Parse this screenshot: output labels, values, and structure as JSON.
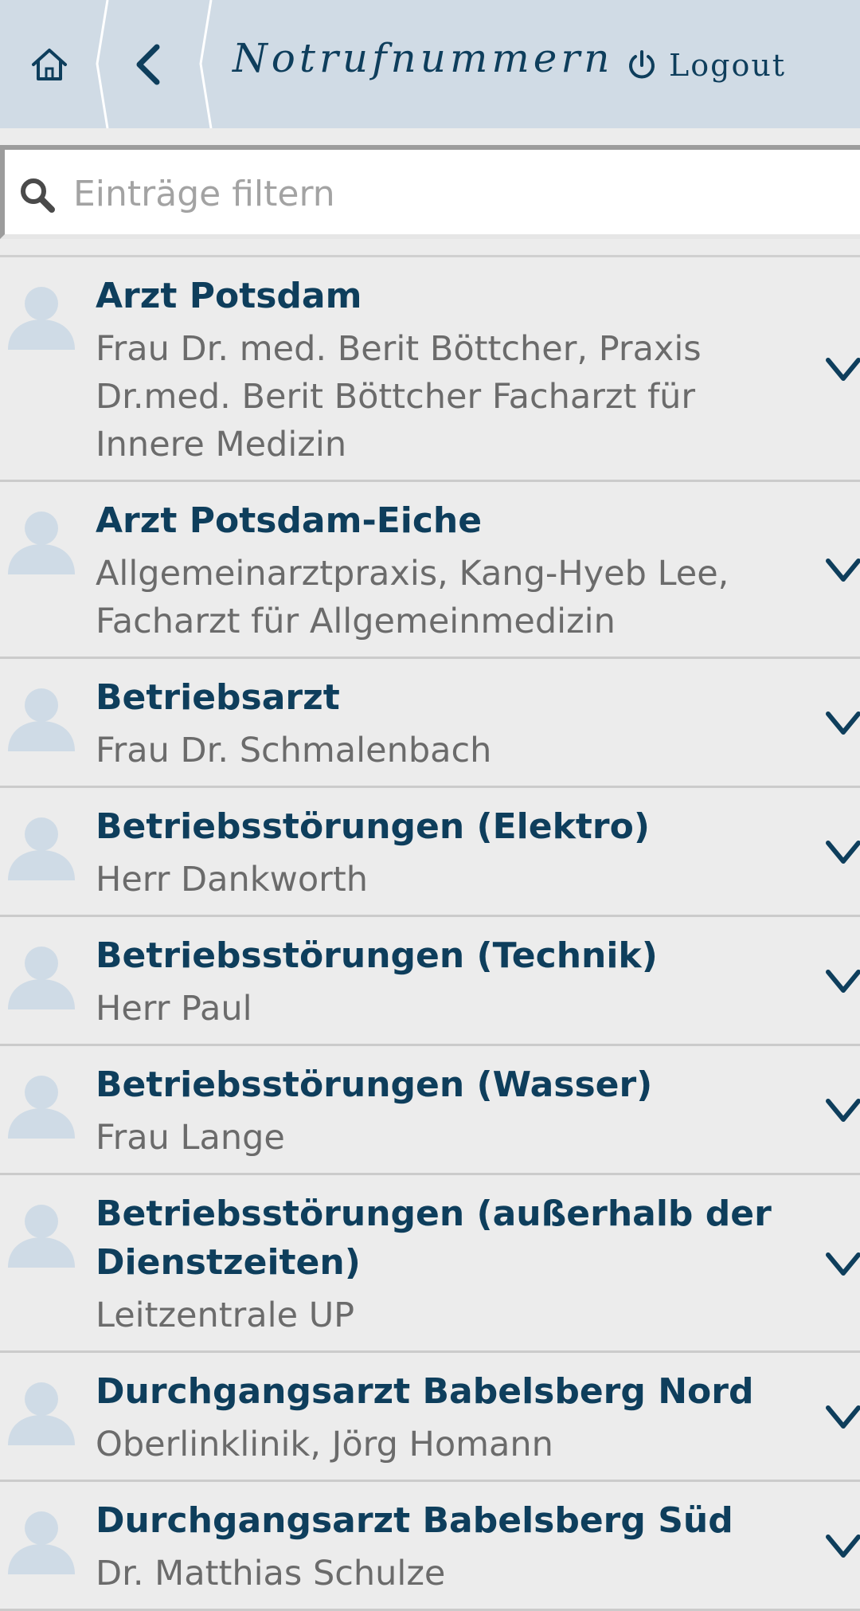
{
  "header": {
    "title": "Notrufnummern",
    "logout_label": "Logout",
    "icons": {
      "home": "home-icon",
      "back": "chevron-left-icon",
      "logout": "power-icon"
    }
  },
  "search": {
    "placeholder": "Einträge filtern",
    "icon": "search-icon"
  },
  "entries": [
    {
      "title": "Arzt Potsdam",
      "subtitle": "Frau Dr. med. Berit Böttcher, Praxis Dr.med. Berit Böttcher Facharzt für Innere Medizin"
    },
    {
      "title": "Arzt Potsdam-Eiche",
      "subtitle": "Allgemeinarztpraxis, Kang-Hyeb Lee, Facharzt für Allgemeinmedizin"
    },
    {
      "title": "Betriebsarzt",
      "subtitle": "Frau Dr. Schmalenbach"
    },
    {
      "title": "Betriebsstörungen (Elektro)",
      "subtitle": "Herr Dankworth"
    },
    {
      "title": "Betriebsstörungen (Technik)",
      "subtitle": "Herr Paul"
    },
    {
      "title": "Betriebsstörungen (Wasser)",
      "subtitle": "Frau Lange"
    },
    {
      "title": "Betriebsstörungen (außerhalb der Dienstzeiten)",
      "subtitle": "Leitzentrale UP"
    },
    {
      "title": "Durchgangsarzt Babelsberg Nord",
      "subtitle": "Oberlinklinik, Jörg Homann"
    },
    {
      "title": "Durchgangsarzt Babelsberg Süd",
      "subtitle": "Dr. Matthias Schulze"
    }
  ],
  "colors": {
    "header_bg": "#d0dbe5",
    "primary": "#0e3e5c",
    "avatar": "#cfdbe6",
    "list_bg": "#ececec",
    "subtitle": "#6b6b6b"
  }
}
